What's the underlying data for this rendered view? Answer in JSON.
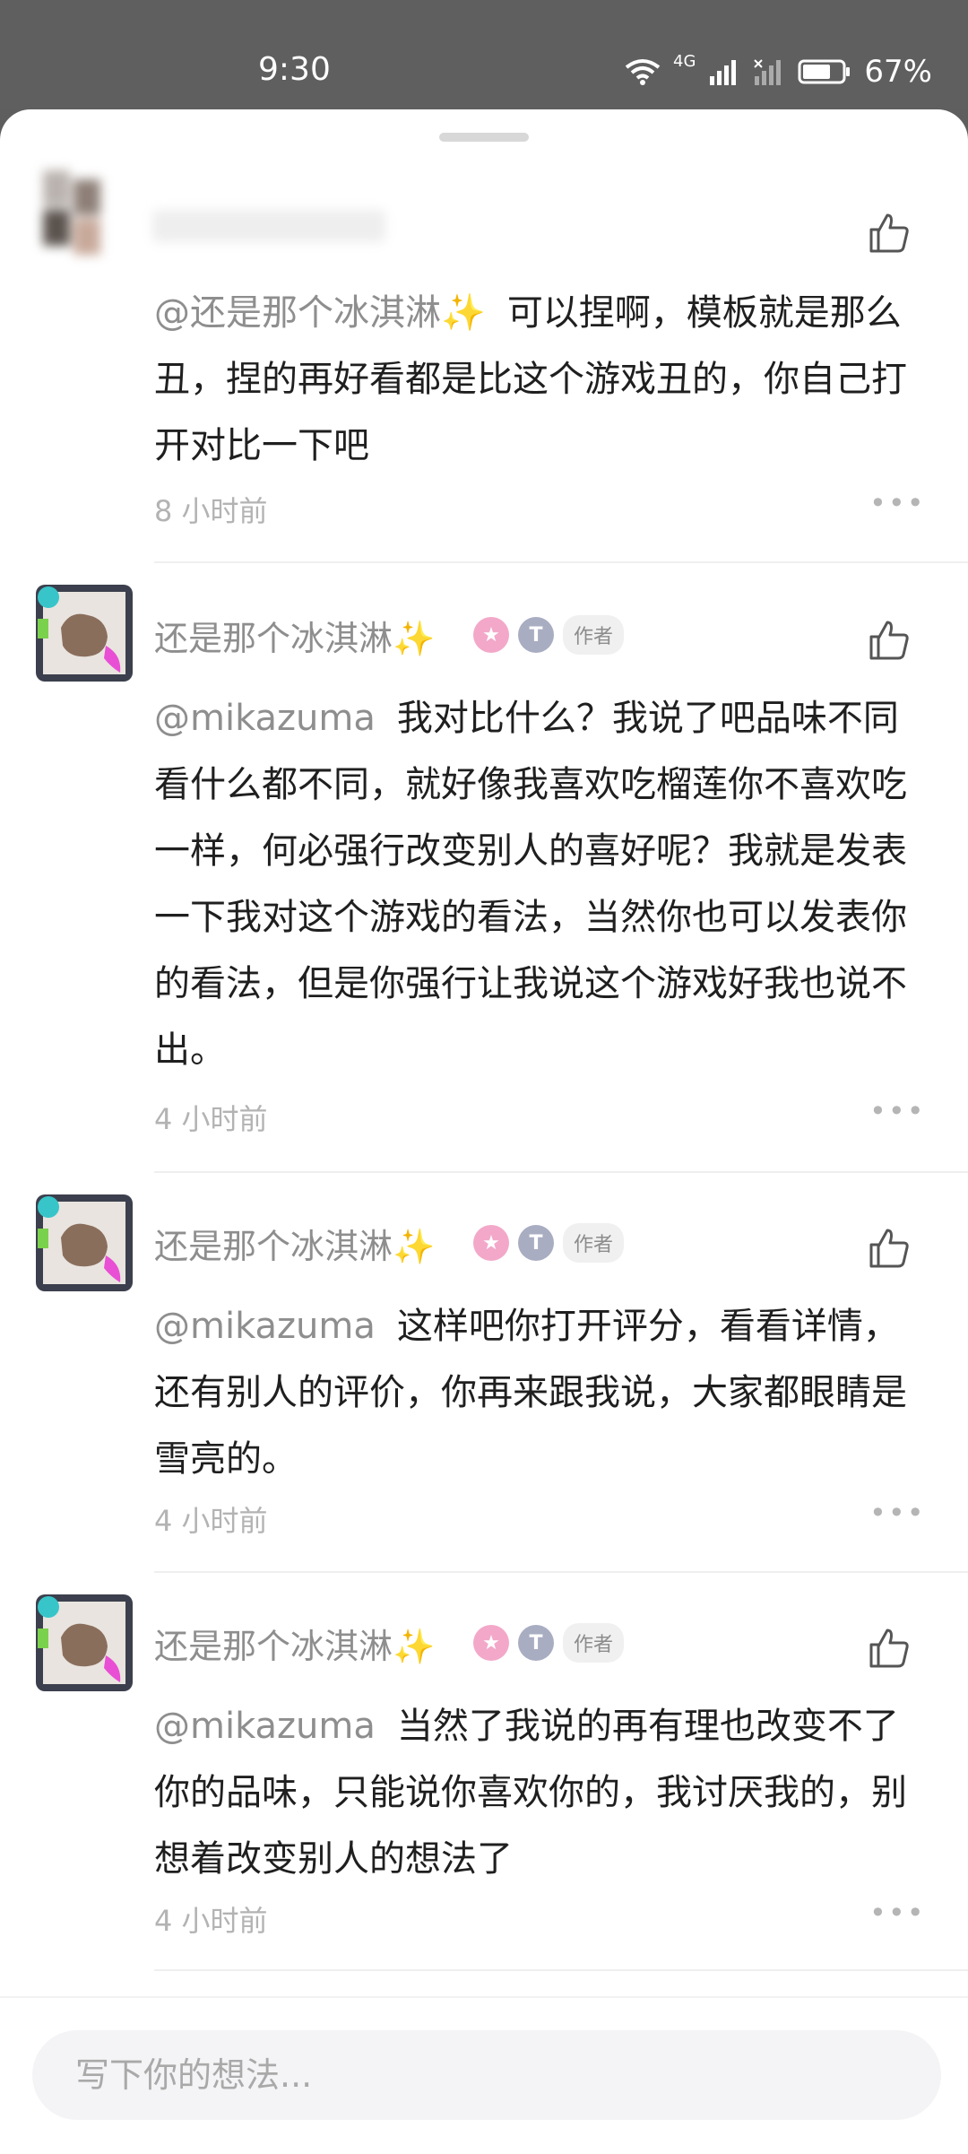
{
  "status": {
    "time": "9:30",
    "network": "4G",
    "battery": "67%"
  },
  "placeholder": "写下你的想法...",
  "comments": [
    {
      "mention": "@还是那个冰淇淋✨",
      "text": "可以捏啊，模板就是那么丑，捏的再好看都是比这个游戏丑的，你自己打开对比一下吧",
      "time": "8 小时前"
    },
    {
      "name": "还是那个冰淇淋✨",
      "author": "作者",
      "mention": "@mikazuma",
      "text": "我对比什么？我说了吧品味不同看什么都不同，就好像我喜欢吃榴莲你不喜欢吃一样，何必强行改变别人的喜好呢？我就是发表一下我对这个游戏的看法，当然你也可以发表你的看法，但是你强行让我说这个游戏好我也说不出。",
      "time": "4 小时前"
    },
    {
      "name": "还是那个冰淇淋✨",
      "author": "作者",
      "mention": "@mikazuma",
      "text": "这样吧你打开评分，看看详情，还有别人的评价，你再来跟我说，大家都眼睛是雪亮的。",
      "time": "4 小时前"
    },
    {
      "name": "还是那个冰淇淋✨",
      "author": "作者",
      "mention": "@mikazuma",
      "text": "当然了我说的再有理也改变不了你的品味，只能说你喜欢你的，我讨厌我的，别想着改变别人的想法了",
      "time": "4 小时前"
    }
  ]
}
